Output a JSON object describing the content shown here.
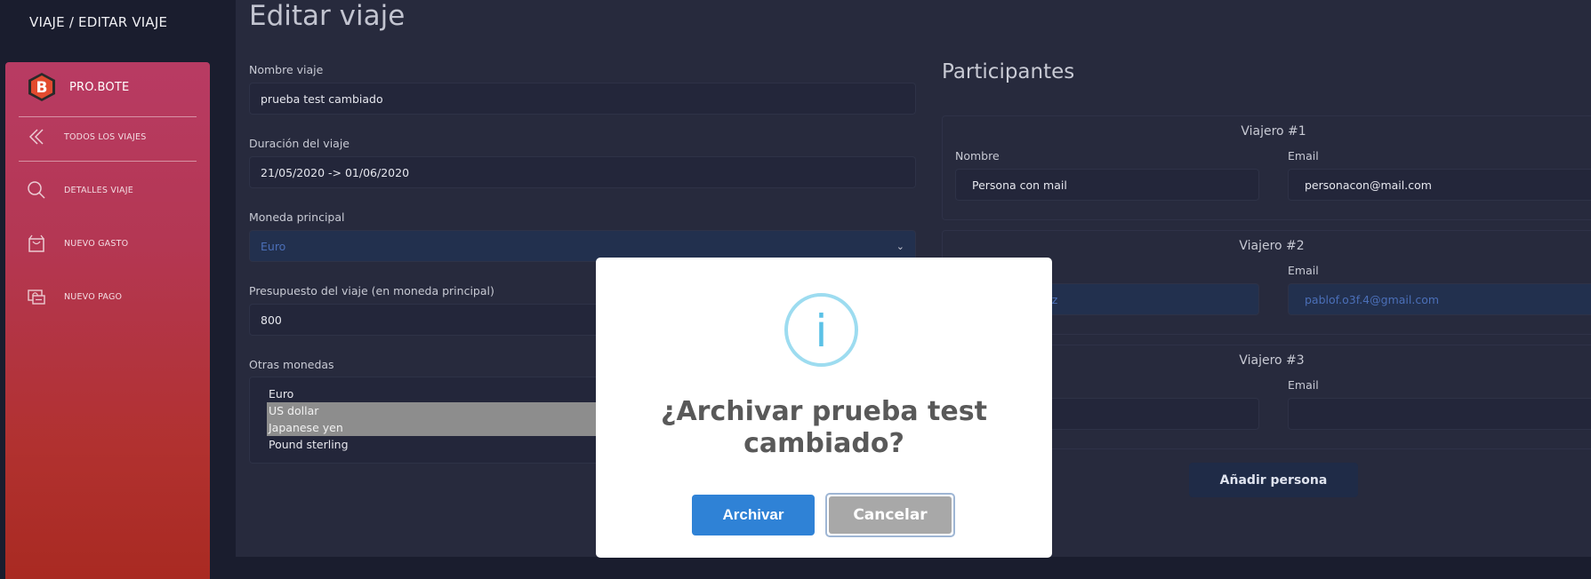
{
  "breadcrumb": "VIAJE / EDITAR VIAJE",
  "brand": {
    "name": "PRO.BOTE",
    "logo": "B"
  },
  "sidebar": {
    "items": [
      {
        "label": "TODOS LOS VIAJES",
        "icon": "chevron-left-double-icon"
      },
      {
        "label": "DETALLES VIAJE",
        "icon": "search-icon"
      },
      {
        "label": "NUEVO GASTO",
        "icon": "shopping-bag-icon"
      },
      {
        "label": "NUEVO PAGO",
        "icon": "money-icon"
      }
    ]
  },
  "page": {
    "title": "Editar viaje"
  },
  "form": {
    "name_label": "Nombre viaje",
    "name_value": "prueba test cambiado",
    "duration_label": "Duración del viaje",
    "duration_value": "21/05/2020 -> 01/06/2020",
    "currency_label": "Moneda principal",
    "currency_value": "Euro",
    "budget_label": "Presupuesto del viaje (en moneda principal)",
    "budget_value": "800",
    "other_currencies_label": "Otras monedas",
    "other_currencies": [
      {
        "label": "Euro",
        "selected": false
      },
      {
        "label": "US dollar",
        "selected": true
      },
      {
        "label": "Japanese yen",
        "selected": true
      },
      {
        "label": "Pound sterling",
        "selected": false
      }
    ]
  },
  "participants": {
    "title": "Participantes",
    "travelers": [
      {
        "title": "Viajero #1",
        "name_label": "Nombre",
        "name_value": "Persona con mail",
        "email_label": "Email",
        "email_value": "personacon@mail.com"
      },
      {
        "title": "Viajero #2",
        "name_label": "",
        "name_value": "ez",
        "email_label": "Email",
        "email_value": "pablof.o3f.4@gmail.com"
      },
      {
        "title": "Viajero #3",
        "name_label": "",
        "name_value": "a",
        "email_label": "Email",
        "email_value": ""
      }
    ],
    "add_button": "Añadir persona"
  },
  "modal": {
    "icon": "info-icon",
    "title": "¿Archivar prueba test cambiado?",
    "confirm": "Archivar",
    "cancel": "Cancelar"
  },
  "colors": {
    "sidebar_top": "#b83b63",
    "sidebar_bottom": "#a92a22",
    "confirm": "#2f82d6",
    "cancel": "#a8a8a8",
    "info": "#5bc1e6"
  }
}
